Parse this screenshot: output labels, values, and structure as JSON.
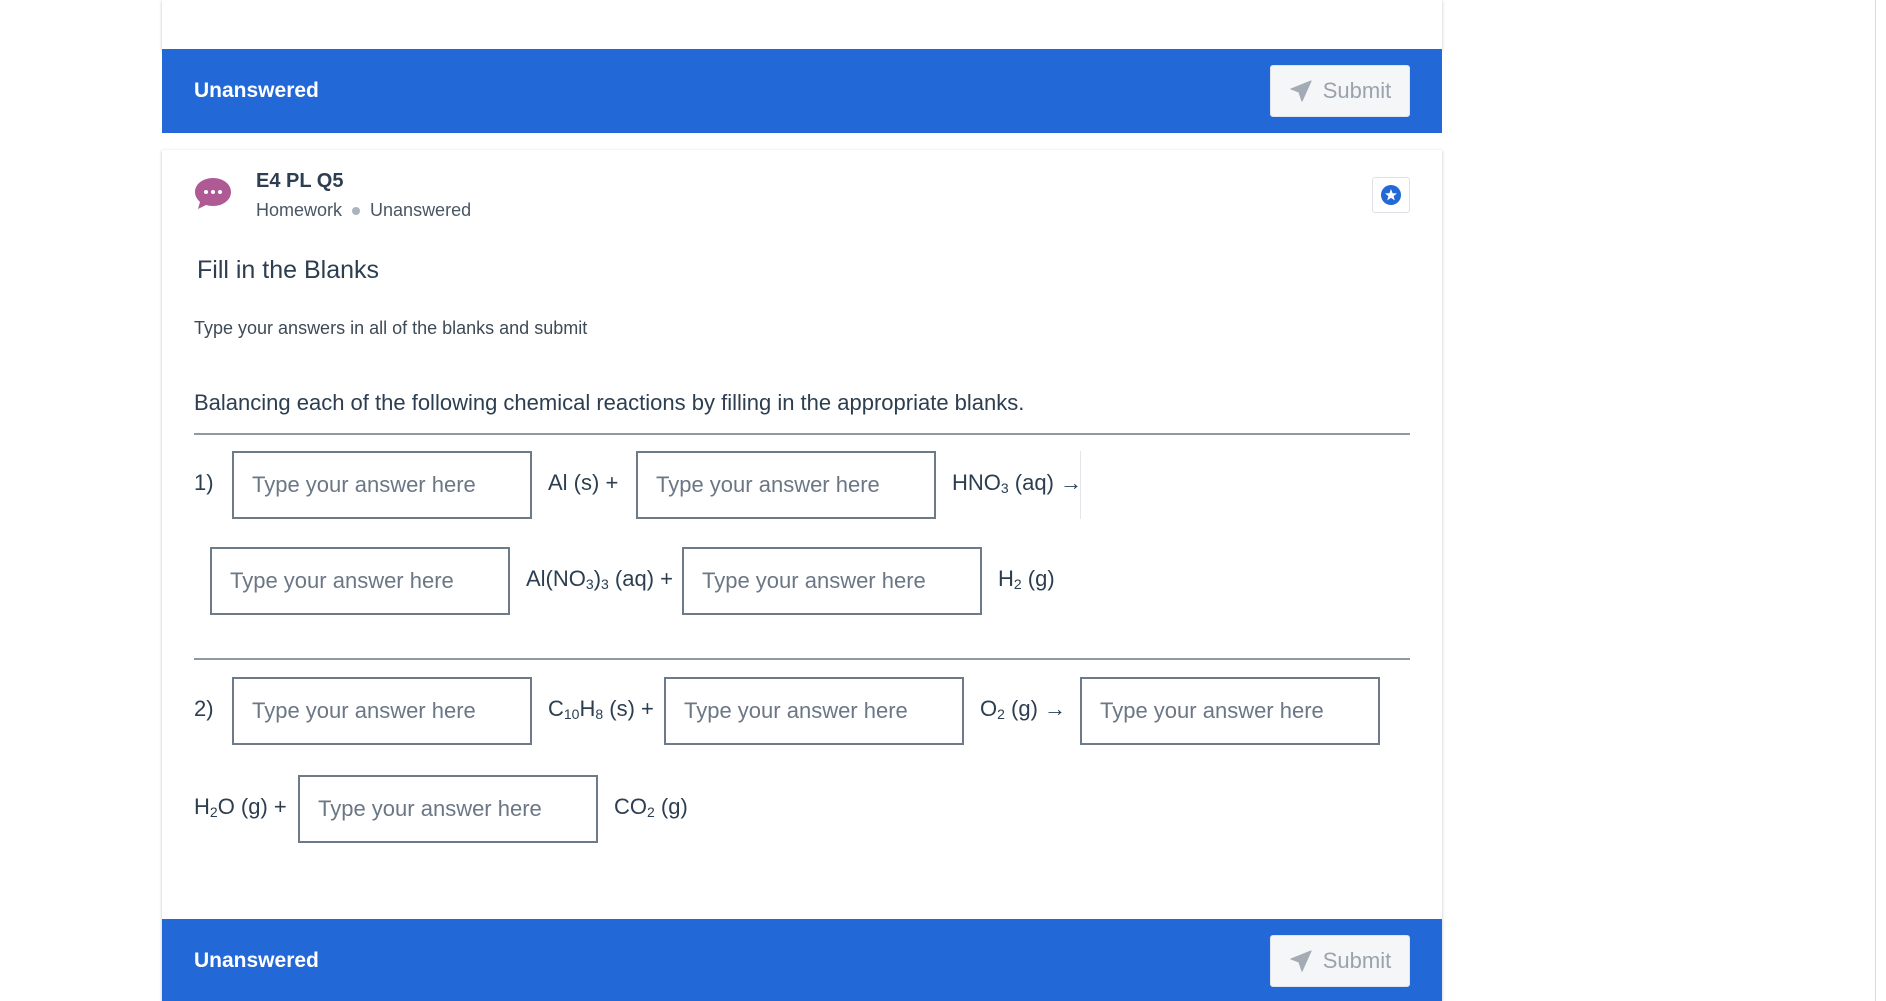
{
  "top_status": {
    "label": "Unanswered",
    "submit_label": "Submit"
  },
  "question": {
    "title": "E4 PL Q5",
    "type": "Homework",
    "status": "Unanswered",
    "heading": "Fill in the Blanks",
    "instructions": "Type your answers in all of the blanks and submit",
    "prompt": "Balancing  each of the following chemical reactions by filling in the appropriate blanks."
  },
  "reaction1": {
    "number": "1)",
    "placeholder": "Type your answer here",
    "t1": "Al (s) +",
    "t2_main": "HNO",
    "t2_sub": "3",
    "t2_tail": " (aq) →",
    "t3_a": "Al(NO",
    "t3_sub1": "3",
    "t3_b": ")",
    "t3_sub2": "3",
    "t3_c": " (aq) +",
    "t4_main": "H",
    "t4_sub": "2",
    "t4_tail": " (g)"
  },
  "reaction2": {
    "number": "2)",
    "placeholder": "Type your answer here",
    "t1_a": "C",
    "t1_sub1": "10",
    "t1_b": "H",
    "t1_sub2": "8",
    "t1_c": " (s) +",
    "t2_main": "O",
    "t2_sub": "2",
    "t2_tail": " (g) →",
    "t3_main": "H",
    "t3_sub": "2",
    "t3_tail": "O (g) +",
    "t4_main": "CO",
    "t4_sub": "2",
    "t4_tail": " (g)"
  },
  "bottom_status": {
    "label": "Unanswered",
    "submit_label": "Submit"
  },
  "colors": {
    "accent": "#2268d6",
    "question_icon": "#b05a95"
  },
  "icons": {
    "question": "chat-bubble-icon",
    "star": "star-icon",
    "send": "paper-plane-icon"
  }
}
